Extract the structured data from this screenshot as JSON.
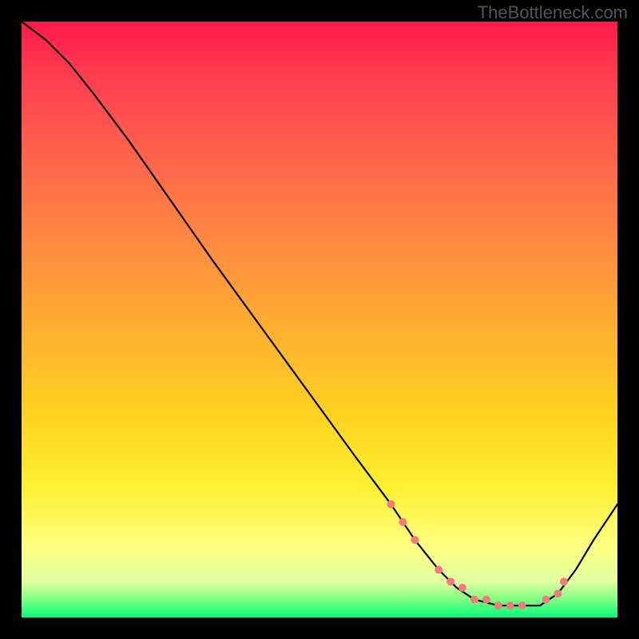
{
  "watermark": "TheBottleneck.com",
  "chart_data": {
    "type": "line",
    "title": "",
    "xlabel": "",
    "ylabel": "",
    "xlim": [
      0,
      100
    ],
    "ylim": [
      0,
      100
    ],
    "note": "Axes are unlabeled in the source image; values below are normalized 0-100 estimates read from relative position within the gradient plot area.",
    "series": [
      {
        "name": "curve",
        "x": [
          0,
          4,
          8,
          12,
          18,
          25,
          32,
          40,
          48,
          56,
          62,
          66,
          70,
          73,
          76,
          80,
          84,
          87,
          90,
          93,
          96,
          100
        ],
        "y": [
          100,
          97,
          93,
          88,
          80,
          70,
          60,
          49,
          38,
          27,
          19,
          13,
          8,
          5,
          3,
          2,
          2,
          2,
          4,
          8,
          13,
          19
        ]
      }
    ],
    "markers": {
      "name": "highlighted-points",
      "color": "#f47b7b",
      "x": [
        62,
        64,
        66,
        70,
        72,
        74,
        76,
        78,
        80,
        82,
        84,
        88,
        90,
        91
      ],
      "y": [
        19,
        16,
        13,
        8,
        6,
        5,
        3,
        3,
        2,
        2,
        2,
        3,
        4,
        6
      ]
    },
    "background_gradient_stops": [
      {
        "pos": 0,
        "color": "#ff1a4a"
      },
      {
        "pos": 25,
        "color": "#ff6a4a"
      },
      {
        "pos": 52,
        "color": "#ffb030"
      },
      {
        "pos": 78,
        "color": "#fff030"
      },
      {
        "pos": 94,
        "color": "#e0ffa0"
      },
      {
        "pos": 100,
        "color": "#00ff7f"
      }
    ]
  }
}
